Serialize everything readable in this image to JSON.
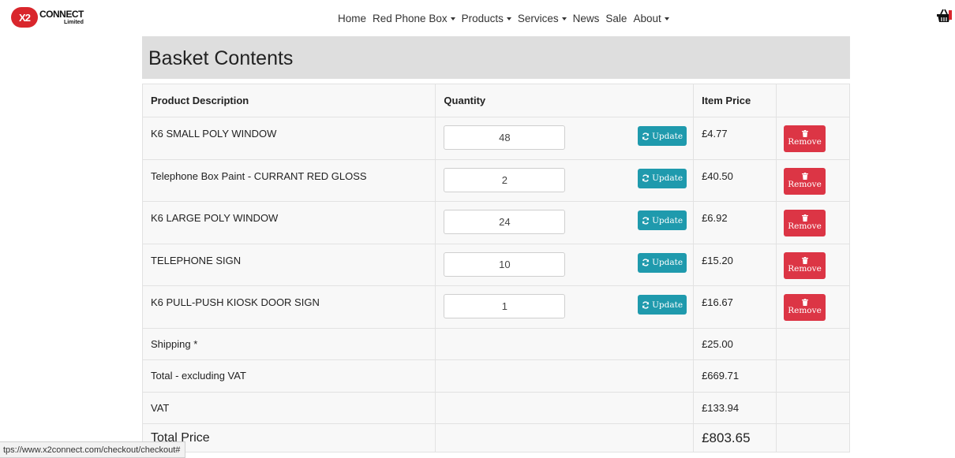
{
  "logo": {
    "badge": "X2",
    "line1": "CONNECT",
    "line2": "Limited"
  },
  "nav": {
    "items": [
      {
        "label": "Home",
        "dropdown": false
      },
      {
        "label": "Red Phone Box",
        "dropdown": true
      },
      {
        "label": "Products",
        "dropdown": true
      },
      {
        "label": "Services",
        "dropdown": true
      },
      {
        "label": "News",
        "dropdown": false
      },
      {
        "label": "Sale",
        "dropdown": false
      },
      {
        "label": "About",
        "dropdown": true
      }
    ]
  },
  "cart": {
    "icon": "basket-icon"
  },
  "page": {
    "title": "Basket Contents"
  },
  "table": {
    "headers": {
      "description": "Product Description",
      "quantity": "Quantity",
      "price": "Item Price"
    },
    "items": [
      {
        "description": "K6 SMALL POLY WINDOW",
        "quantity": "48",
        "price": "£4.77"
      },
      {
        "description": "Telephone Box Paint - CURRANT RED GLOSS",
        "quantity": "2",
        "price": "£40.50"
      },
      {
        "description": "K6 LARGE POLY WINDOW",
        "quantity": "24",
        "price": "£6.92"
      },
      {
        "description": "TELEPHONE SIGN",
        "quantity": "10",
        "price": "£15.20"
      },
      {
        "description": "K6 PULL-PUSH KIOSK DOOR SIGN",
        "quantity": "1",
        "price": "£16.67"
      }
    ],
    "update_label": "Update",
    "remove_label": "Remove",
    "summary": [
      {
        "label": "Shipping *",
        "value": "£25.00"
      },
      {
        "label": "Total - excluding VAT",
        "value": "£669.71"
      },
      {
        "label": "VAT",
        "value": "£133.94"
      }
    ],
    "total": {
      "label": "Total Price",
      "value": "£803.65"
    }
  },
  "status": {
    "url": "tps://www.x2connect.com/checkout/checkout#"
  },
  "colors": {
    "update": "#1f9aad",
    "remove": "#dc3545",
    "heading_bg": "#dedede",
    "logo_red": "#d9262c"
  }
}
